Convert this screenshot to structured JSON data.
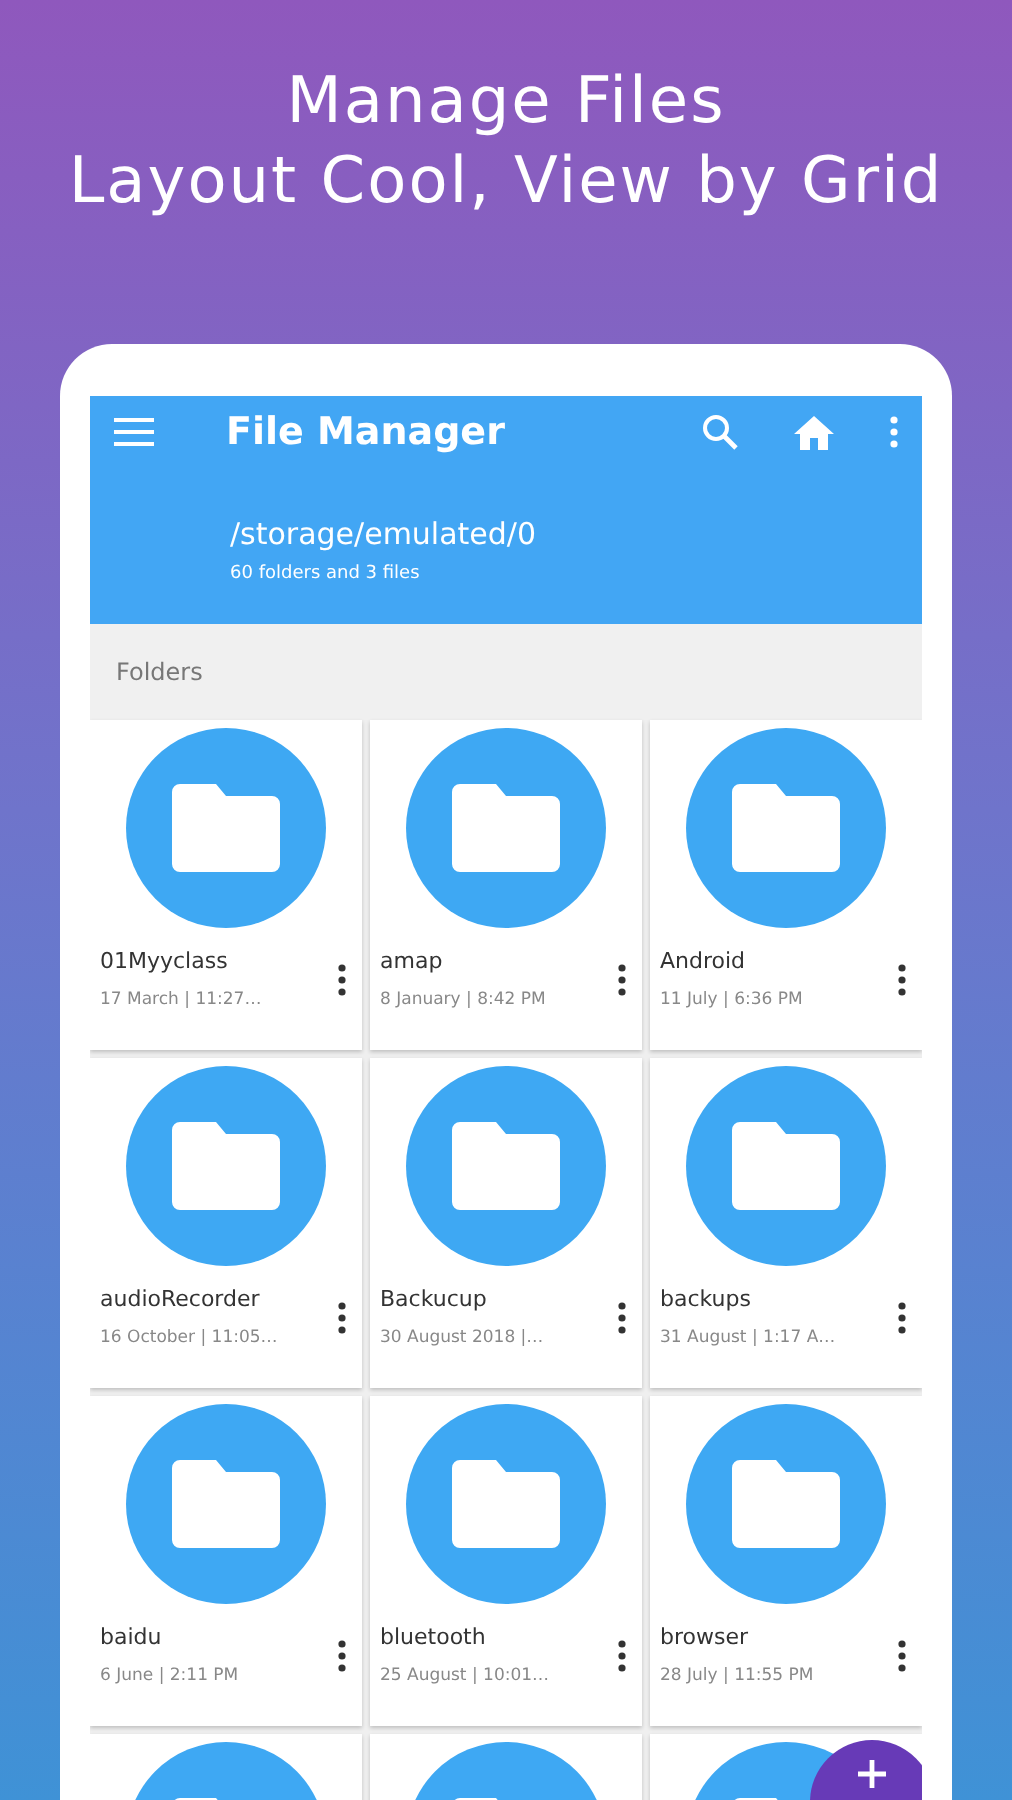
{
  "headline": [
    "Manage Files",
    "Layout Cool, View by Grid"
  ],
  "app_bar": {
    "title": "File Manager"
  },
  "path": {
    "location": "/storage/emulated/0",
    "summary": "60 folders and 3 files"
  },
  "section": {
    "title": "Folders"
  },
  "folders": [
    {
      "kind": "folder",
      "name": "01Myyclass",
      "date": "17 March | 11:27…"
    },
    {
      "kind": "folder",
      "name": "amap",
      "date": "8 January | 8:42 PM"
    },
    {
      "kind": "folder",
      "name": "Android",
      "date": "11 July | 6:36 PM"
    },
    {
      "kind": "folder",
      "name": "audioRecorder",
      "date": "16 October | 11:05…"
    },
    {
      "kind": "folder",
      "name": "Backucup",
      "date": "30 August 2018 |…"
    },
    {
      "kind": "folder",
      "name": "backups",
      "date": "31 August | 1:17 A…"
    },
    {
      "kind": "folder",
      "name": "baidu",
      "date": "6 June | 2:11 PM"
    },
    {
      "kind": "folder",
      "name": "bluetooth",
      "date": "25 August | 10:01…"
    },
    {
      "kind": "folder",
      "name": "browser",
      "date": "28 July | 11:55 PM"
    },
    {
      "kind": "folder"
    },
    {
      "kind": "folder"
    },
    {
      "kind": "folder"
    }
  ],
  "fab": {
    "visible": true
  }
}
